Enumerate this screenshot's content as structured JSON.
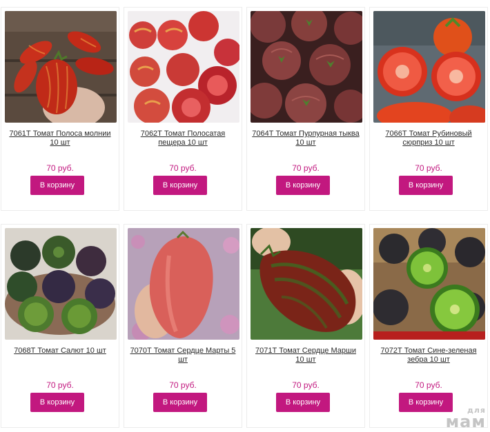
{
  "products": [
    {
      "title": "7061Т Томат Полоса молнии 10 шт",
      "price": "70 руб.",
      "button": "В корзину"
    },
    {
      "title": "7062Т Томат Полосатая пещера 10 шт",
      "price": "70 руб.",
      "button": "В корзину"
    },
    {
      "title": "7064Т Томат Пурпурная тыква 10 шт",
      "price": "70 руб.",
      "button": "В корзину"
    },
    {
      "title": "7066Т Томат Рубиновый сюрприз 10 шт",
      "price": "70 руб.",
      "button": "В корзину"
    },
    {
      "title": "7068Т Томат Салют 10 шт",
      "price": "70 руб.",
      "button": "В корзину"
    },
    {
      "title": "7070Т Томат Сердце Марты 5 шт",
      "price": "70 руб.",
      "button": "В корзину"
    },
    {
      "title": "7071Т Томат Сердце Марши 10 шт",
      "price": "70 руб.",
      "button": "В корзину"
    },
    {
      "title": "7072Т Томат Сине-зеленая зебра 10 шт",
      "price": "70 руб.",
      "button": "В корзину"
    }
  ],
  "watermark": {
    "line1": "для",
    "line2": "мам"
  },
  "colors": {
    "accent": "#c2187f",
    "title_text": "#2a2a2a",
    "card_border": "#ececec"
  }
}
